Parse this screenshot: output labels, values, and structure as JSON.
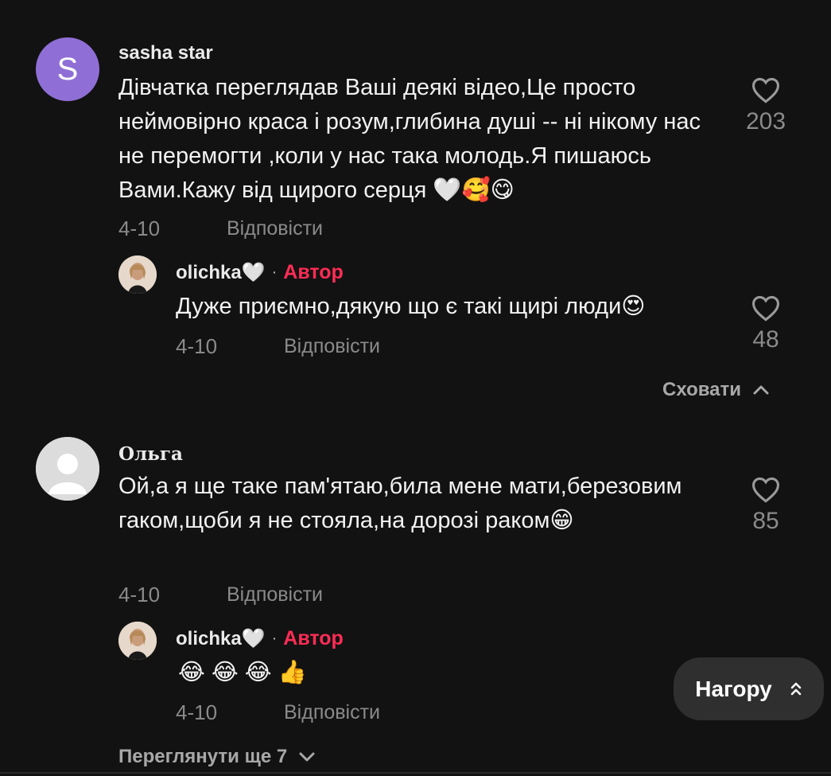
{
  "comments": [
    {
      "avatar_letter": "S",
      "username": "sasha star",
      "text": "Дівчатка переглядав Ваші деякі відео,Це просто неймовірно краса і розум,глибина душі -- ні нікому нас не перемогти ,коли у нас така молодь.Я пишаюсь Вами.Кажу від щирого серця 🤍🥰😋",
      "date": "4-10",
      "reply_label": "Відповісти",
      "likes": "203",
      "replies": [
        {
          "username": "olichka🤍",
          "separator": "·",
          "author_badge": "Автор",
          "text": "Дуже приємно,дякую що є такі щирі люди😍",
          "date": "4-10",
          "reply_label": "Відповісти",
          "likes": "48"
        }
      ],
      "hide_label": "Сховати"
    },
    {
      "username": "Ольга",
      "text": "Ой,а я ще таке пам'ятаю,била мене мати,березовим гаком,щоби я не стояла,на дорозі раком😁",
      "date": "4-10",
      "reply_label": "Відповісти",
      "likes": "85",
      "replies": [
        {
          "username": "olichka🤍",
          "separator": "·",
          "author_badge": "Автор",
          "text": "😂😂😂👍",
          "date": "4-10",
          "reply_label": "Відповісти"
        }
      ],
      "more_label": "Переглянути ще 7"
    }
  ],
  "back_to_top_label": "Нагору",
  "colors": {
    "background": "#121212",
    "author": "#fe2c55",
    "avatar_letter_bg": "#8f6fd6"
  }
}
